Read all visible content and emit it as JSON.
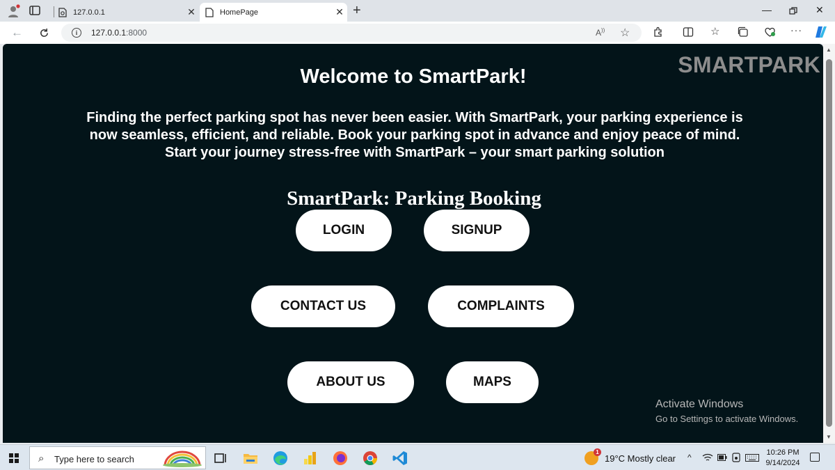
{
  "browser": {
    "tabs": [
      {
        "title": "127.0.0.1",
        "active": false
      },
      {
        "title": "HomePage",
        "active": true
      }
    ],
    "close_glyph": "✕",
    "new_tab_glyph": "+",
    "address": {
      "host": "127.0.0.1",
      "port": ":8000"
    }
  },
  "page": {
    "brand": "SMARTPARK",
    "welcome": "Welcome to SmartPark!",
    "intro": "Finding the perfect parking spot has never been easier. With SmartPark, your parking experience is now seamless, efficient, and reliable. Book your parking spot in advance and enjoy peace of mind. Start your journey stress-free with SmartPark – your smart parking solution",
    "subtitle": "SmartPark: Parking Booking",
    "buttons": {
      "login": "LOGIN",
      "signup": "SIGNUP",
      "contact": "CONTACT US",
      "complaints": "COMPLAINTS",
      "about": "ABOUT US",
      "maps": "MAPS"
    },
    "colors": {
      "background": "#031419",
      "button": "#ffffff",
      "brand": "#8d8d8d"
    }
  },
  "watermark": {
    "title": "Activate Windows",
    "subtitle": "Go to Settings to activate Windows."
  },
  "taskbar": {
    "search_placeholder": "Type here to search",
    "weather": {
      "badge": "1",
      "text": "19°C  Mostly clear"
    },
    "time": "10:26 PM",
    "date": "9/14/2024"
  }
}
